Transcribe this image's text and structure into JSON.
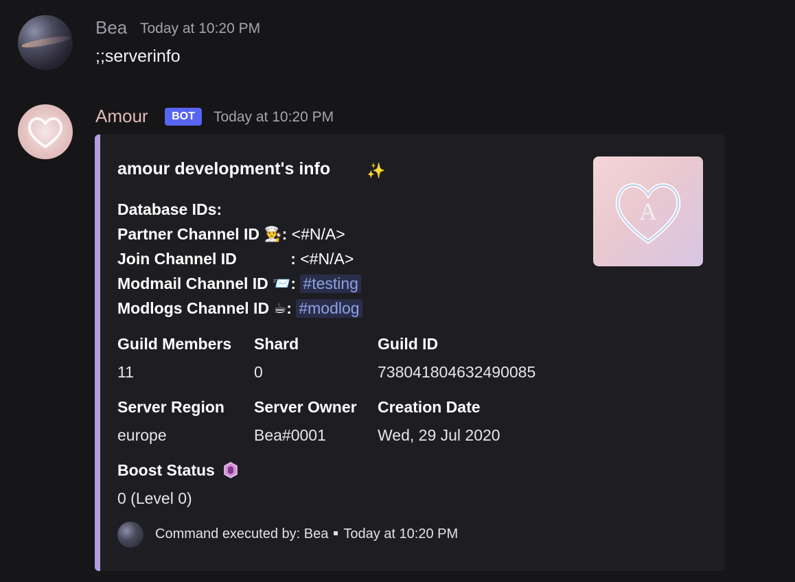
{
  "messages": [
    {
      "author": "Bea",
      "timestamp": "Today at 10:20 PM",
      "content": ";;serverinfo"
    },
    {
      "author": "Amour",
      "badge": "BOT",
      "timestamp": "Today at 10:20 PM"
    }
  ],
  "embed": {
    "accent_color": "#b39ddb",
    "title": "amour development's info",
    "title_icon": "sparkles-icon",
    "database_heading": "Database IDs:",
    "partner_label": "Partner Channel ID",
    "partner_value": "<#N/A>",
    "join_label": "Join Channel ID",
    "join_value": "<#N/A>",
    "modmail_label": "Modmail Channel ID",
    "modmail_value": "#testing",
    "modlogs_label": "Modlogs Channel ID",
    "modlogs_value": "#modlog",
    "fields": [
      {
        "name": "Guild Members",
        "value": "11"
      },
      {
        "name": "Shard",
        "value": "0"
      },
      {
        "name": "Guild ID",
        "value": "738041804632490085"
      },
      {
        "name": "Server Region",
        "value": "europe"
      },
      {
        "name": "Server Owner",
        "value": "Bea#0001"
      },
      {
        "name": "Creation Date",
        "value": "Wed, 29 Jul 2020"
      },
      {
        "name": "Boost Status",
        "value": "0 (Level 0)"
      }
    ],
    "footer_text": "Command executed by: Bea",
    "footer_timestamp": "Today at 10:20 PM",
    "mention_color": "#8ea1e1",
    "bot_badge_color": "#5865f2"
  }
}
